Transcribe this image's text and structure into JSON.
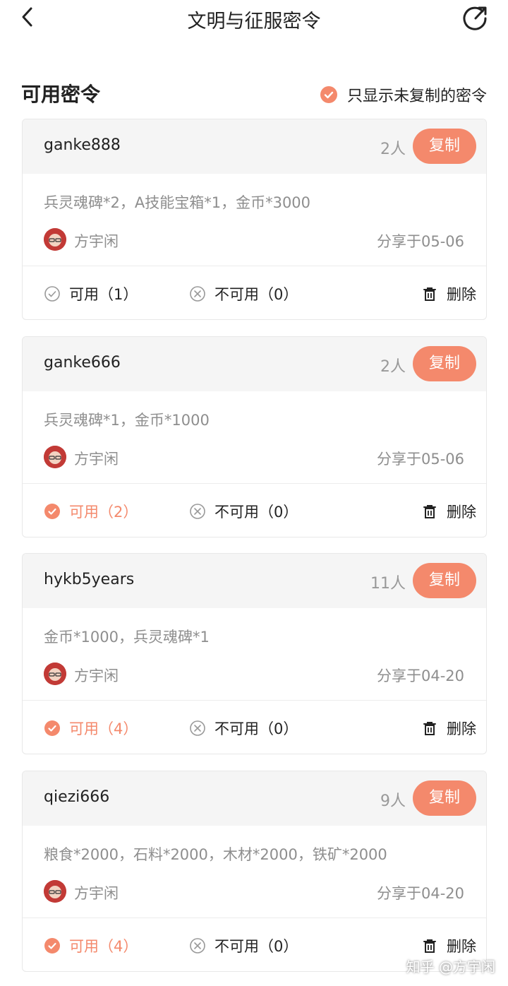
{
  "header": {
    "title": "文明与征服密令"
  },
  "section": {
    "title": "可用密令",
    "filter_label": "只显示未复制的密令",
    "filter_checked": true
  },
  "accent_color": "#f4896c",
  "cards": [
    {
      "code": "ganke888",
      "count": "2人",
      "copy_label": "复制",
      "rewards": "兵灵魂碑*2，A技能宝箱*1，金币*3000",
      "author": "方宇闲",
      "shared": "分享于05-06",
      "usable_label": "可用（1）",
      "usable_active": false,
      "unusable_label": "不可用（0）",
      "delete_label": "删除"
    },
    {
      "code": "ganke666",
      "count": "2人",
      "copy_label": "复制",
      "rewards": "兵灵魂碑*1，金币*1000",
      "author": "方宇闲",
      "shared": "分享于05-06",
      "usable_label": "可用（2）",
      "usable_active": true,
      "unusable_label": "不可用（0）",
      "delete_label": "删除"
    },
    {
      "code": "hykb5years",
      "count": "11人",
      "copy_label": "复制",
      "rewards": "金币*1000，兵灵魂碑*1",
      "author": "方宇闲",
      "shared": "分享于04-20",
      "usable_label": "可用（4）",
      "usable_active": true,
      "unusable_label": "不可用（0）",
      "delete_label": "删除"
    },
    {
      "code": "qiezi666",
      "count": "9人",
      "copy_label": "复制",
      "rewards": "粮食*2000，石料*2000，木材*2000，铁矿*2000",
      "author": "方宇闲",
      "shared": "分享于04-20",
      "usable_label": "可用（4）",
      "usable_active": true,
      "unusable_label": "不可用（0）",
      "delete_label": "删除"
    }
  ],
  "watermark": "知乎 @方宇闲"
}
